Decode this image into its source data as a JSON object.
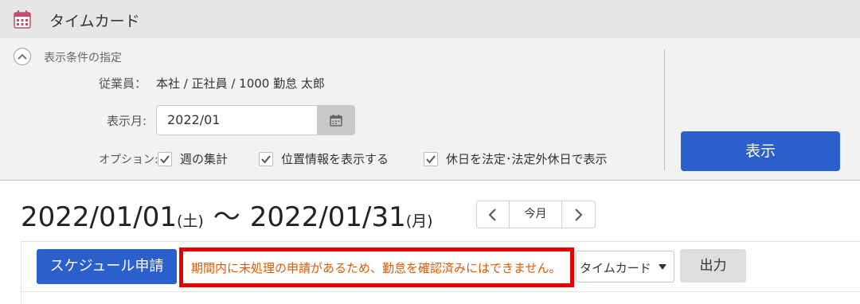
{
  "header": {
    "title": "タイムカード",
    "icon": "calendar-icon"
  },
  "conditions": {
    "section_title": "表示条件の指定",
    "employee_label": "従業員：",
    "employee_value": "本社 / 正社員 / 1000 勤怠 太郎",
    "month_label": "表示月:",
    "month_value": "2022/01",
    "options_label": "オプション:",
    "options": [
      {
        "label": "週の集計",
        "checked": true
      },
      {
        "label": "位置情報を表示する",
        "checked": true
      },
      {
        "label": "休日を法定･法定外休日で表示",
        "checked": true
      }
    ],
    "show_button": "表示"
  },
  "period": {
    "start": "2022/01/01",
    "start_weekday": "(土)",
    "separator": "〜",
    "end": "2022/01/31",
    "end_weekday": "(月)"
  },
  "nav": {
    "today_label": "今月"
  },
  "toolbar": {
    "schedule_button": "スケジュール申請",
    "warning": "期間内に未処理の申請があるため、勤怠を確認済みにはできません。",
    "type_select_value": "タイムカード",
    "output_button": "出力"
  },
  "colors": {
    "accent": "#2b5fcc",
    "warning_border": "#e60000",
    "warning_text": "#e05a00"
  }
}
